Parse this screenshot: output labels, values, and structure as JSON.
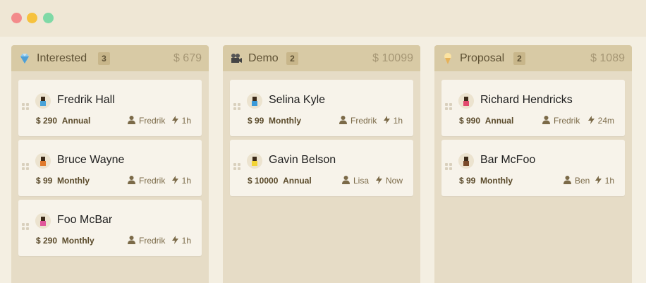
{
  "window": {
    "buttons": [
      "close",
      "minimize",
      "zoom"
    ]
  },
  "columns": [
    {
      "title": "Interested",
      "icon": "diamond-icon",
      "count": "3",
      "total": "$ 679",
      "cards": [
        {
          "name": "Fredrik Hall",
          "price": "$ 290",
          "plan": "Annual",
          "user": "Fredrik",
          "time": "1h",
          "avatar_icon": "character-avatar-icon",
          "avatar_color": "#4aa3d8"
        },
        {
          "name": "Bruce Wayne",
          "price": "$ 99",
          "plan": "Monthly",
          "user": "Fredrik",
          "time": "1h",
          "avatar_icon": "character-avatar-icon",
          "avatar_color": "#e07a2c"
        },
        {
          "name": "Foo McBar",
          "price": "$ 290",
          "plan": "Monthly",
          "user": "Fredrik",
          "time": "1h",
          "avatar_icon": "character-avatar-icon",
          "avatar_color": "#e0569a"
        }
      ]
    },
    {
      "title": "Demo",
      "icon": "film-camera-icon",
      "count": "2",
      "total": "$ 10099",
      "cards": [
        {
          "name": "Selina Kyle",
          "price": "$ 99",
          "plan": "Monthly",
          "user": "Fredrik",
          "time": "1h",
          "avatar_icon": "character-avatar-icon",
          "avatar_color": "#3b9ad9"
        },
        {
          "name": "Gavin Belson",
          "price": "$ 10000",
          "plan": "Annual",
          "user": "Lisa",
          "time": "Now",
          "avatar_icon": "character-avatar-icon",
          "avatar_color": "#f2d335"
        }
      ]
    },
    {
      "title": "Proposal",
      "icon": "ice-cream-icon",
      "count": "2",
      "total": "$ 1089",
      "cards": [
        {
          "name": "Richard Hendricks",
          "price": "$ 990",
          "plan": "Annual",
          "user": "Fredrik",
          "time": "24m",
          "avatar_icon": "character-avatar-icon",
          "avatar_color": "#e2496e"
        },
        {
          "name": "Bar McFoo",
          "price": "$ 99",
          "plan": "Monthly",
          "user": "Ben",
          "time": "1h",
          "avatar_icon": "character-avatar-icon",
          "avatar_color": "#7a4a2a"
        }
      ]
    }
  ]
}
